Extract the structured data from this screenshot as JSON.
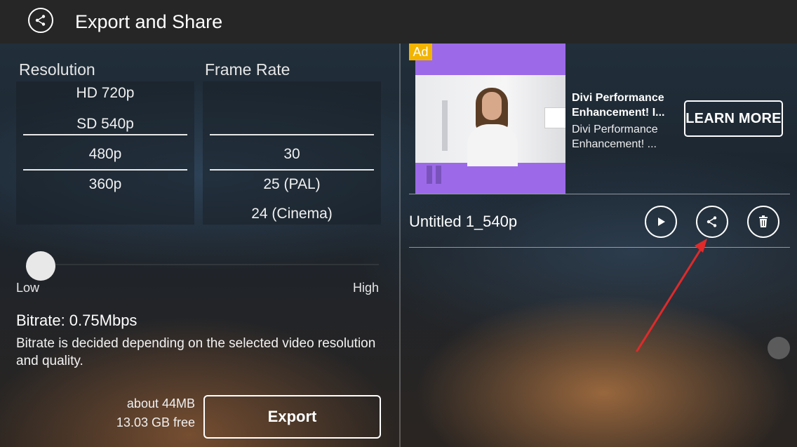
{
  "header": {
    "title": "Export and Share",
    "back_icon": "share-back-icon"
  },
  "resolution": {
    "label": "Resolution",
    "options": [
      "HD 720p",
      "SD 540p",
      "480p",
      "360p"
    ]
  },
  "frame_rate": {
    "label": "Frame Rate",
    "options": [
      "30",
      "25 (PAL)",
      "24 (Cinema)"
    ]
  },
  "quality_slider": {
    "low_label": "Low",
    "high_label": "High",
    "value": 0
  },
  "bitrate": {
    "text": "Bitrate: 0.75Mbps",
    "note": "Bitrate is decided depending on the selected video resolution and quality."
  },
  "storage": {
    "estimate": "about 44MB",
    "free": "13.03 GB free"
  },
  "export_label": "Export",
  "ad": {
    "badge": "Ad",
    "headline": "Divi Performance Enhancement! I...",
    "description": "Divi Performance Enhancement! ...",
    "cta": "LEARN MORE",
    "accent_color": "#9c6ae8"
  },
  "file": {
    "name": "Untitled 1_540p",
    "actions": [
      "play-icon",
      "share-icon",
      "trash-icon"
    ]
  },
  "annotation": {
    "color": "#e02a2a"
  }
}
